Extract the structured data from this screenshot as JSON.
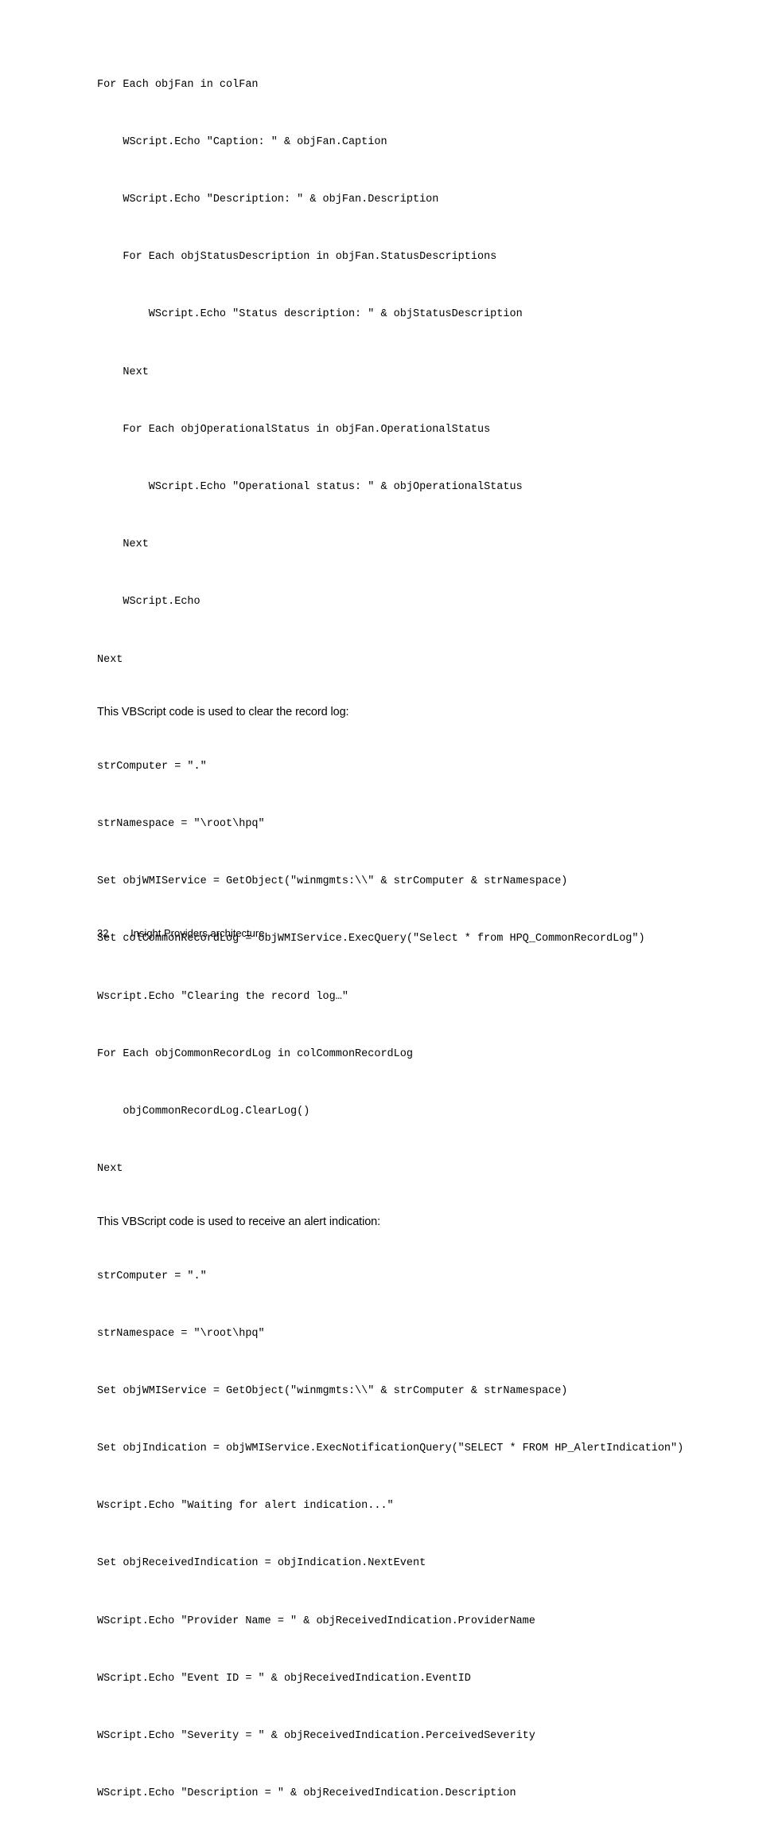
{
  "code1": {
    "lines": [
      "For Each objFan in colFan",
      "    WScript.Echo \"Caption: \" & objFan.Caption",
      "    WScript.Echo \"Description: \" & objFan.Description",
      "    For Each objStatusDescription in objFan.StatusDescriptions",
      "        WScript.Echo \"Status description: \" & objStatusDescription",
      "    Next",
      "    For Each objOperationalStatus in objFan.OperationalStatus",
      "        WScript.Echo \"Operational status: \" & objOperationalStatus",
      "    Next",
      "    WScript.Echo",
      "Next"
    ]
  },
  "prose1": "This VBScript code is used to clear the record log:",
  "code2": {
    "lines": [
      "strComputer = \".\"",
      "strNamespace = \"\\root\\hpq\"",
      "Set objWMIService = GetObject(\"winmgmts:\\\\\" & strComputer & strNamespace)",
      "Set colCommonRecordLog = objWMIService.ExecQuery(\"Select * from HPQ_CommonRecordLog\")",
      "Wscript.Echo \"Clearing the record log…\"",
      "For Each objCommonRecordLog in colCommonRecordLog",
      "    objCommonRecordLog.ClearLog()",
      "Next"
    ]
  },
  "prose2": "This VBScript code is used to receive an alert indication:",
  "code3": {
    "lines": [
      "strComputer = \".\"",
      "strNamespace = \"\\root\\hpq\"",
      "Set objWMIService = GetObject(\"winmgmts:\\\\\" & strComputer & strNamespace)",
      "Set objIndication = objWMIService.ExecNotificationQuery(\"SELECT * FROM HP_AlertIndication\")",
      "Wscript.Echo \"Waiting for alert indication...\"",
      "Set objReceivedIndication = objIndication.NextEvent",
      "WScript.Echo \"Provider Name = \" & objReceivedIndication.ProviderName",
      "WScript.Echo \"Event ID = \" & objReceivedIndication.EventID",
      "WScript.Echo \"Severity = \" & objReceivedIndication.PerceivedSeverity",
      "WScript.Echo \"Description = \" & objReceivedIndication.Description"
    ]
  },
  "footer": {
    "page": "32",
    "title": "Insight Providers architecture"
  }
}
